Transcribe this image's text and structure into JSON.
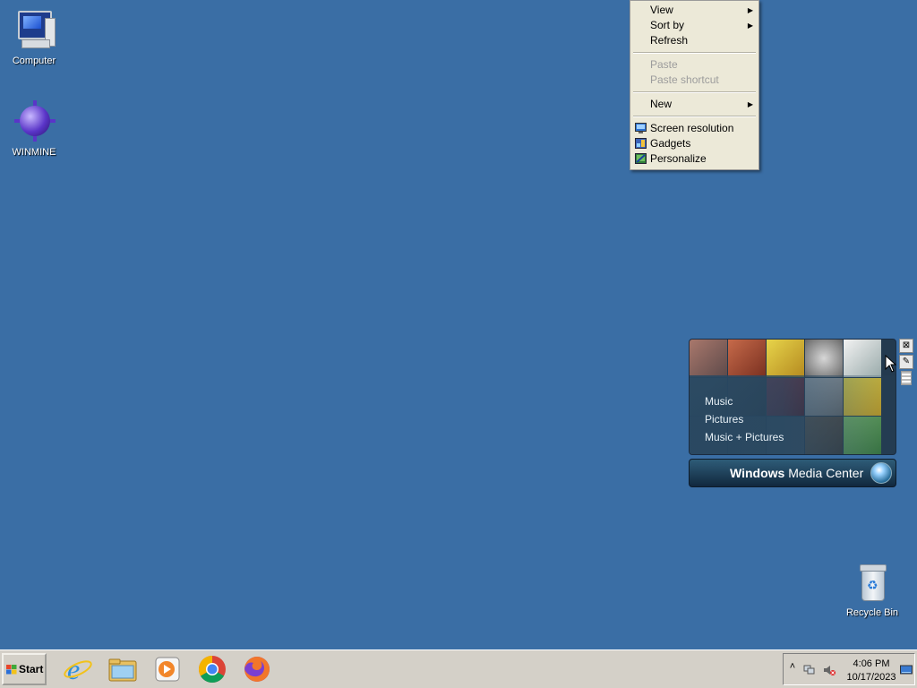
{
  "desktop": {
    "icons": [
      {
        "label": "Computer"
      },
      {
        "label": "WINMINE"
      },
      {
        "label": "Recycle Bin"
      }
    ]
  },
  "context_menu": {
    "items": [
      {
        "label": "View",
        "submenu": true,
        "enabled": true
      },
      {
        "label": "Sort by",
        "submenu": true,
        "enabled": true
      },
      {
        "label": "Refresh",
        "enabled": true
      },
      {
        "label": "Paste",
        "enabled": false
      },
      {
        "label": "Paste shortcut",
        "enabled": false
      },
      {
        "label": "New",
        "submenu": true,
        "enabled": true
      },
      {
        "label": "Screen resolution",
        "icon": "screen-resolution-icon",
        "enabled": true
      },
      {
        "label": "Gadgets",
        "icon": "gadgets-icon",
        "enabled": true
      },
      {
        "label": "Personalize",
        "icon": "personalize-icon",
        "enabled": true
      }
    ]
  },
  "media_center_gadget": {
    "options": [
      "Music",
      "Pictures",
      "Music + Pictures"
    ],
    "title_bold": "Windows",
    "title_rest": " Media Center",
    "close_glyph": "⊠",
    "settings_glyph": "✎"
  },
  "taskbar": {
    "start_label": "Start",
    "apps": [
      {
        "icon": "internet-explorer-icon"
      },
      {
        "icon": "file-explorer-icon"
      },
      {
        "icon": "media-player-icon"
      },
      {
        "icon": "chrome-icon"
      },
      {
        "icon": "firefox-icon"
      }
    ],
    "tray": {
      "expand_glyph": "˄",
      "time": "4:06 PM",
      "date": "10/17/2023"
    }
  },
  "colors": {
    "desktop_bg": "#3a6ea5",
    "taskbar_bg": "#d4d0c8",
    "menu_bg": "#ece9d8"
  }
}
